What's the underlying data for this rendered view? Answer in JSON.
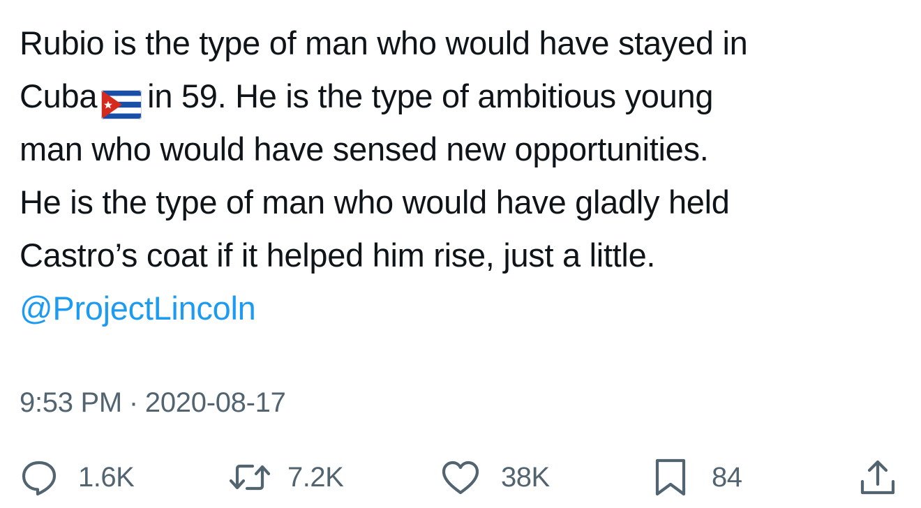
{
  "tweet": {
    "lines": [
      "Rubio is the type of man who would have stayed in",
      "Cuba",
      "in 59. He is the type of ambitious young",
      "man who would have sensed new opportunities.",
      "He is the type of man who would have gladly held",
      "Castro’s coat if it helped him rise, just a little."
    ],
    "flag_icon": "cuba-flag-emoji",
    "mention": "@ProjectLincoln"
  },
  "meta": {
    "time": "9:53 PM",
    "separator": "·",
    "date": "2020-08-17"
  },
  "actions": {
    "replies": {
      "icon": "reply-bubble-icon",
      "count": "1.6K"
    },
    "retweets": {
      "icon": "retweet-icon",
      "count": "7.2K"
    },
    "likes": {
      "icon": "heart-icon",
      "count": "38K"
    },
    "bookmarks": {
      "icon": "bookmark-icon",
      "count": "84"
    },
    "share": {
      "icon": "share-upload-icon"
    }
  },
  "colors": {
    "text": "#0f1419",
    "secondary": "#536471",
    "link": "#1d9bf0"
  }
}
